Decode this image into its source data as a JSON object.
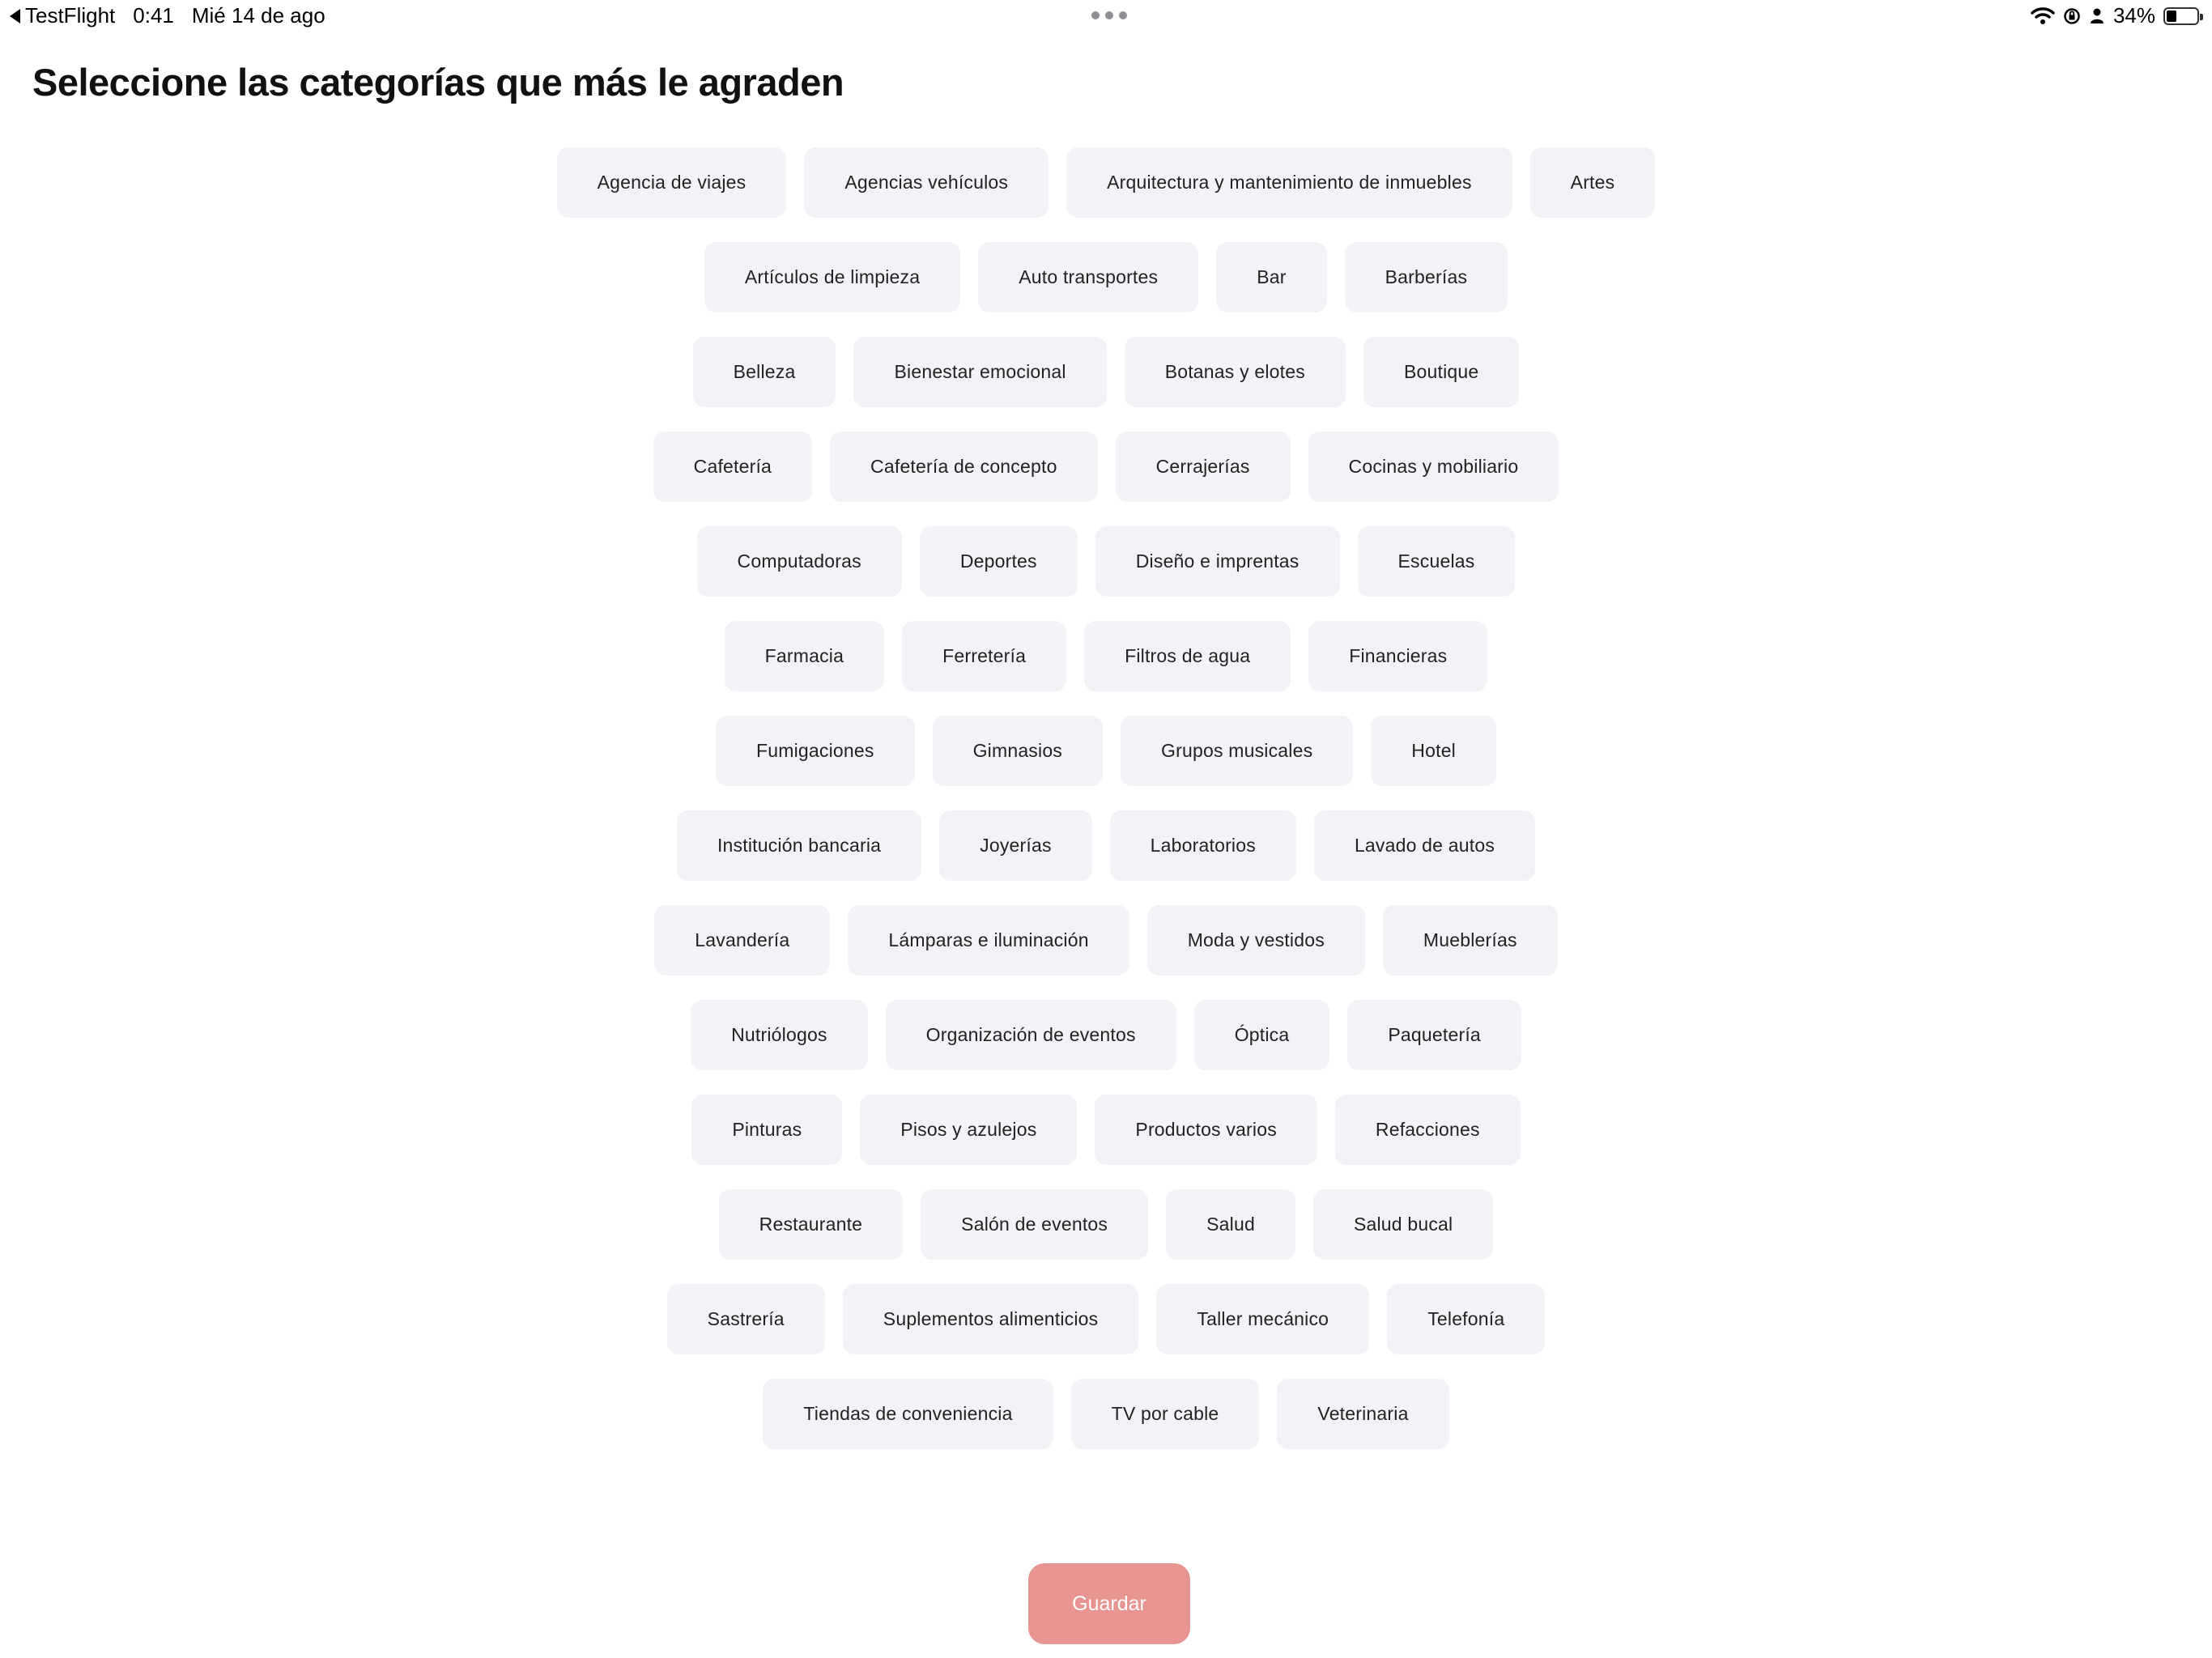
{
  "status_bar": {
    "back_app": "TestFlight",
    "time": "0:41",
    "date": "Mié 14 de ago",
    "battery_percent": "34%",
    "battery_level": 0.34
  },
  "title": "Seleccione las categorías que más le agraden",
  "categories": [
    [
      "Agencia de viajes",
      "Agencias vehículos",
      "Arquitectura y mantenimiento de inmuebles",
      "Artes"
    ],
    [
      "Artículos de limpieza",
      "Auto transportes",
      "Bar",
      "Barberías"
    ],
    [
      "Belleza",
      "Bienestar emocional",
      "Botanas y elotes",
      "Boutique"
    ],
    [
      "Cafetería",
      "Cafetería de concepto",
      "Cerrajerías",
      "Cocinas y mobiliario"
    ],
    [
      "Computadoras",
      "Deportes",
      "Diseño e imprentas",
      "Escuelas"
    ],
    [
      "Farmacia",
      "Ferretería",
      "Filtros de agua",
      "Financieras"
    ],
    [
      "Fumigaciones",
      "Gimnasios",
      "Grupos musicales",
      "Hotel"
    ],
    [
      "Institución bancaria",
      "Joyerías",
      "Laboratorios",
      "Lavado de autos"
    ],
    [
      "Lavandería",
      "Lámparas e iluminación",
      "Moda y vestidos",
      "Mueblerías"
    ],
    [
      "Nutriólogos",
      "Organización de eventos",
      "Óptica",
      "Paquetería"
    ],
    [
      "Pinturas",
      "Pisos y azulejos",
      "Productos varios",
      "Refacciones"
    ],
    [
      "Restaurante",
      "Salón de eventos",
      "Salud",
      "Salud bucal"
    ],
    [
      "Sastrería",
      "Suplementos alimenticios",
      "Taller mecánico",
      "Telefonía"
    ],
    [
      "Tiendas de conveniencia",
      "TV por cable",
      "Veterinaria"
    ]
  ],
  "save_button": {
    "label": "Guardar",
    "color": "#e89490"
  },
  "colors": {
    "chip_bg": "#f2f3f6",
    "text": "#111111"
  }
}
